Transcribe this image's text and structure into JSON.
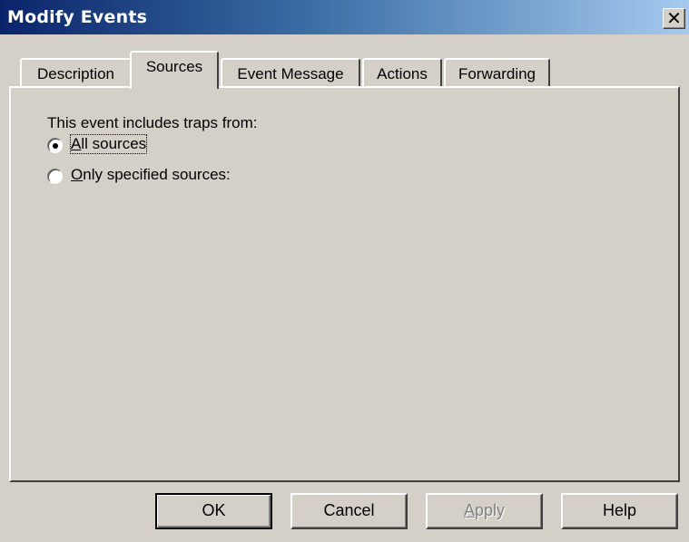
{
  "window": {
    "title": "Modify Events",
    "close_glyph": "✕"
  },
  "tabs": [
    {
      "label": "Description",
      "active": false
    },
    {
      "label": "Sources",
      "active": true
    },
    {
      "label": "Event Message",
      "active": false
    },
    {
      "label": "Actions",
      "active": false
    },
    {
      "label": "Forwarding",
      "active": false
    }
  ],
  "sources_panel": {
    "intro": "This event includes traps from:",
    "options": [
      {
        "mnemonic": "A",
        "rest": "ll sources",
        "selected": true
      },
      {
        "mnemonic": "O",
        "rest": "nly specified sources:",
        "selected": false
      }
    ]
  },
  "buttons": {
    "ok": "OK",
    "cancel": "Cancel",
    "apply_mnemonic": "A",
    "apply_rest": "pply",
    "help": "Help"
  }
}
